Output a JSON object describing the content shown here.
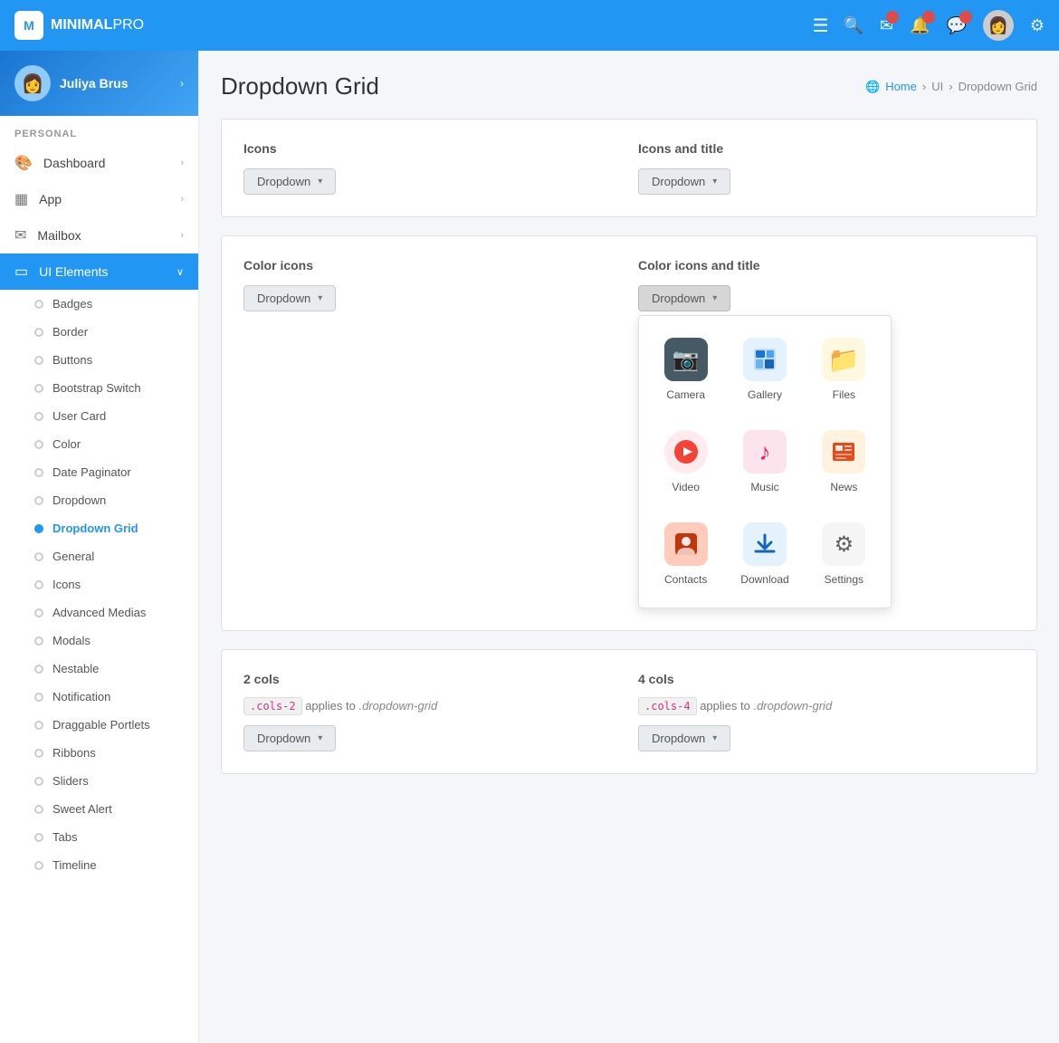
{
  "app": {
    "name_bold": "MINIMAL",
    "name_light": "PRO"
  },
  "navbar": {
    "hamburger_label": "☰",
    "icons": [
      {
        "name": "search-icon",
        "glyph": "🔍",
        "badge": false
      },
      {
        "name": "mail-icon",
        "glyph": "✉",
        "badge": true
      },
      {
        "name": "bell-icon",
        "glyph": "🔔",
        "badge": true
      },
      {
        "name": "chat-icon",
        "glyph": "💬",
        "badge": true
      }
    ],
    "avatar_glyph": "👤",
    "settings_glyph": "⚙"
  },
  "sidebar": {
    "user": {
      "name": "Juliya Brus",
      "avatar_glyph": "👩"
    },
    "section_label": "PERSONAL",
    "nav_items": [
      {
        "id": "dashboard",
        "label": "Dashboard",
        "icon": "🎨",
        "has_chevron": true,
        "active": false
      },
      {
        "id": "app",
        "label": "App",
        "icon": "▦",
        "has_chevron": true,
        "active": false
      },
      {
        "id": "mailbox",
        "label": "Mailbox",
        "icon": "✉",
        "has_chevron": true,
        "active": false
      },
      {
        "id": "ui-elements",
        "label": "UI Elements",
        "icon": "▭",
        "has_chevron": true,
        "active": true
      }
    ],
    "sub_items": [
      {
        "id": "badges",
        "label": "Badges",
        "active": false
      },
      {
        "id": "border",
        "label": "Border",
        "active": false
      },
      {
        "id": "buttons",
        "label": "Buttons",
        "active": false
      },
      {
        "id": "bootstrap-switch",
        "label": "Bootstrap Switch",
        "active": false
      },
      {
        "id": "user-card",
        "label": "User Card",
        "active": false
      },
      {
        "id": "color",
        "label": "Color",
        "active": false
      },
      {
        "id": "date-paginator",
        "label": "Date Paginator",
        "active": false
      },
      {
        "id": "dropdown",
        "label": "Dropdown",
        "active": false
      },
      {
        "id": "dropdown-grid",
        "label": "Dropdown Grid",
        "active": true
      },
      {
        "id": "general",
        "label": "General",
        "active": false
      },
      {
        "id": "icons",
        "label": "Icons",
        "active": false
      },
      {
        "id": "advanced-medias",
        "label": "Advanced Medias",
        "active": false
      },
      {
        "id": "modals",
        "label": "Modals",
        "active": false
      },
      {
        "id": "nestable",
        "label": "Nestable",
        "active": false
      },
      {
        "id": "notification",
        "label": "Notification",
        "active": false
      },
      {
        "id": "draggable-portlets",
        "label": "Draggable Portlets",
        "active": false
      },
      {
        "id": "ribbons",
        "label": "Ribbons",
        "active": false
      },
      {
        "id": "sliders",
        "label": "Sliders",
        "active": false
      },
      {
        "id": "sweet-alert",
        "label": "Sweet Alert",
        "active": false
      },
      {
        "id": "tabs",
        "label": "Tabs",
        "active": false
      },
      {
        "id": "timeline",
        "label": "Timeline",
        "active": false
      }
    ]
  },
  "page": {
    "title": "Dropdown Grid",
    "breadcrumb": [
      "Home",
      "UI",
      "Dropdown Grid"
    ]
  },
  "sections": [
    {
      "id": "icons",
      "title": "Icons",
      "dropdown_label": "Dropdown"
    },
    {
      "id": "icons-and-title",
      "title": "Icons and title",
      "dropdown_label": "Dropdown",
      "show_grid": false
    },
    {
      "id": "color-icons",
      "title": "Color icons",
      "dropdown_label": "Dropdown"
    },
    {
      "id": "color-icons-and-title",
      "title": "Color icons and title",
      "dropdown_label": "Dropdown",
      "show_grid": true
    }
  ],
  "dropdown_grid": {
    "items": [
      {
        "id": "camera",
        "label": "Camera",
        "icon": "📷",
        "color_class": "icon-camera"
      },
      {
        "id": "gallery",
        "label": "Gallery",
        "icon": "🖼",
        "color_class": "icon-gallery"
      },
      {
        "id": "files",
        "label": "Files",
        "icon": "📁",
        "color_class": "icon-files"
      },
      {
        "id": "video",
        "label": "Video",
        "icon": "▶",
        "color_class": "icon-video"
      },
      {
        "id": "music",
        "label": "Music",
        "icon": "♪",
        "color_class": "icon-music"
      },
      {
        "id": "news",
        "label": "News",
        "icon": "📰",
        "color_class": "icon-news"
      },
      {
        "id": "contacts",
        "label": "Contacts",
        "icon": "👤",
        "color_class": "icon-contacts"
      },
      {
        "id": "download",
        "label": "Download",
        "icon": "⬇",
        "color_class": "icon-download"
      },
      {
        "id": "settings",
        "label": "Settings",
        "icon": "⚙",
        "color_class": "icon-settings"
      }
    ]
  },
  "cols_sections": [
    {
      "id": "2cols",
      "title": "2 cols",
      "badge": ".cols-2",
      "applies_to": ".dropdown-grid",
      "dropdown_label": "Dropdown"
    },
    {
      "id": "4cols",
      "title": "4 cols",
      "badge": ".cols-4",
      "applies_to": ".dropdown-grid",
      "dropdown_label": "Dropdown"
    }
  ]
}
